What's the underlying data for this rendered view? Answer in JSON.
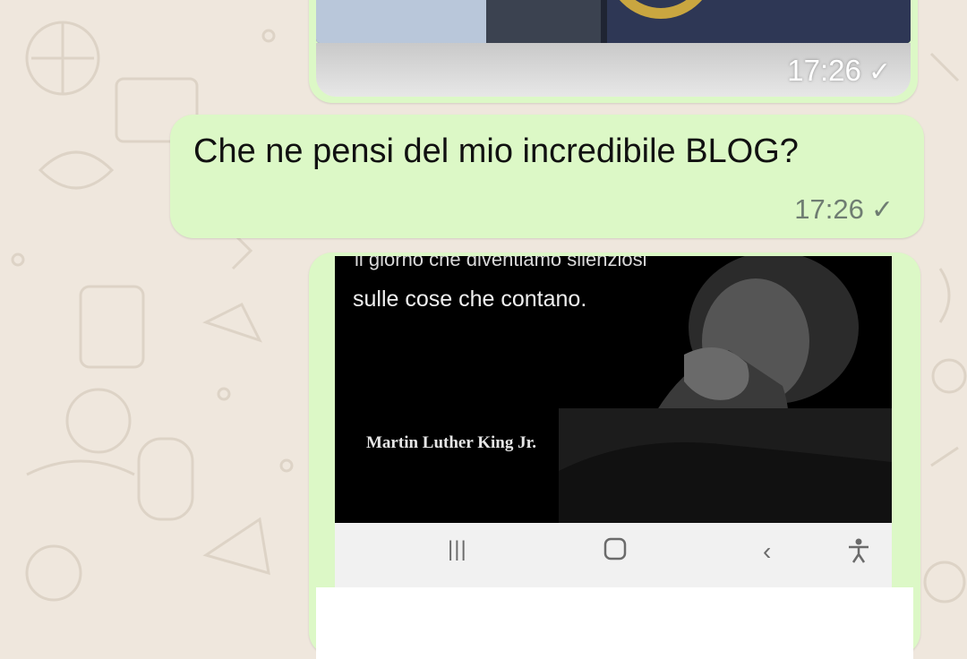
{
  "messages": [
    {
      "type": "image",
      "time": "17:26",
      "status_icon": "single-check"
    },
    {
      "type": "text",
      "text": "Che ne pensi del mio incredibile BLOG?",
      "time": "17:26",
      "status_icon": "single-check"
    },
    {
      "type": "image",
      "quote_lines": [
        "il giorno che diventiamo silenziosi",
        "sulle cose che contano."
      ],
      "attribution": "Martin Luther King Jr."
    }
  ],
  "colors": {
    "chat_bg": "#efe7dd",
    "outgoing_bubble": "#dcf8c6"
  },
  "screenshot_navbar": {
    "recents": "recents-icon",
    "home": "home-icon",
    "back": "back-icon",
    "accessibility": "accessibility-icon"
  }
}
